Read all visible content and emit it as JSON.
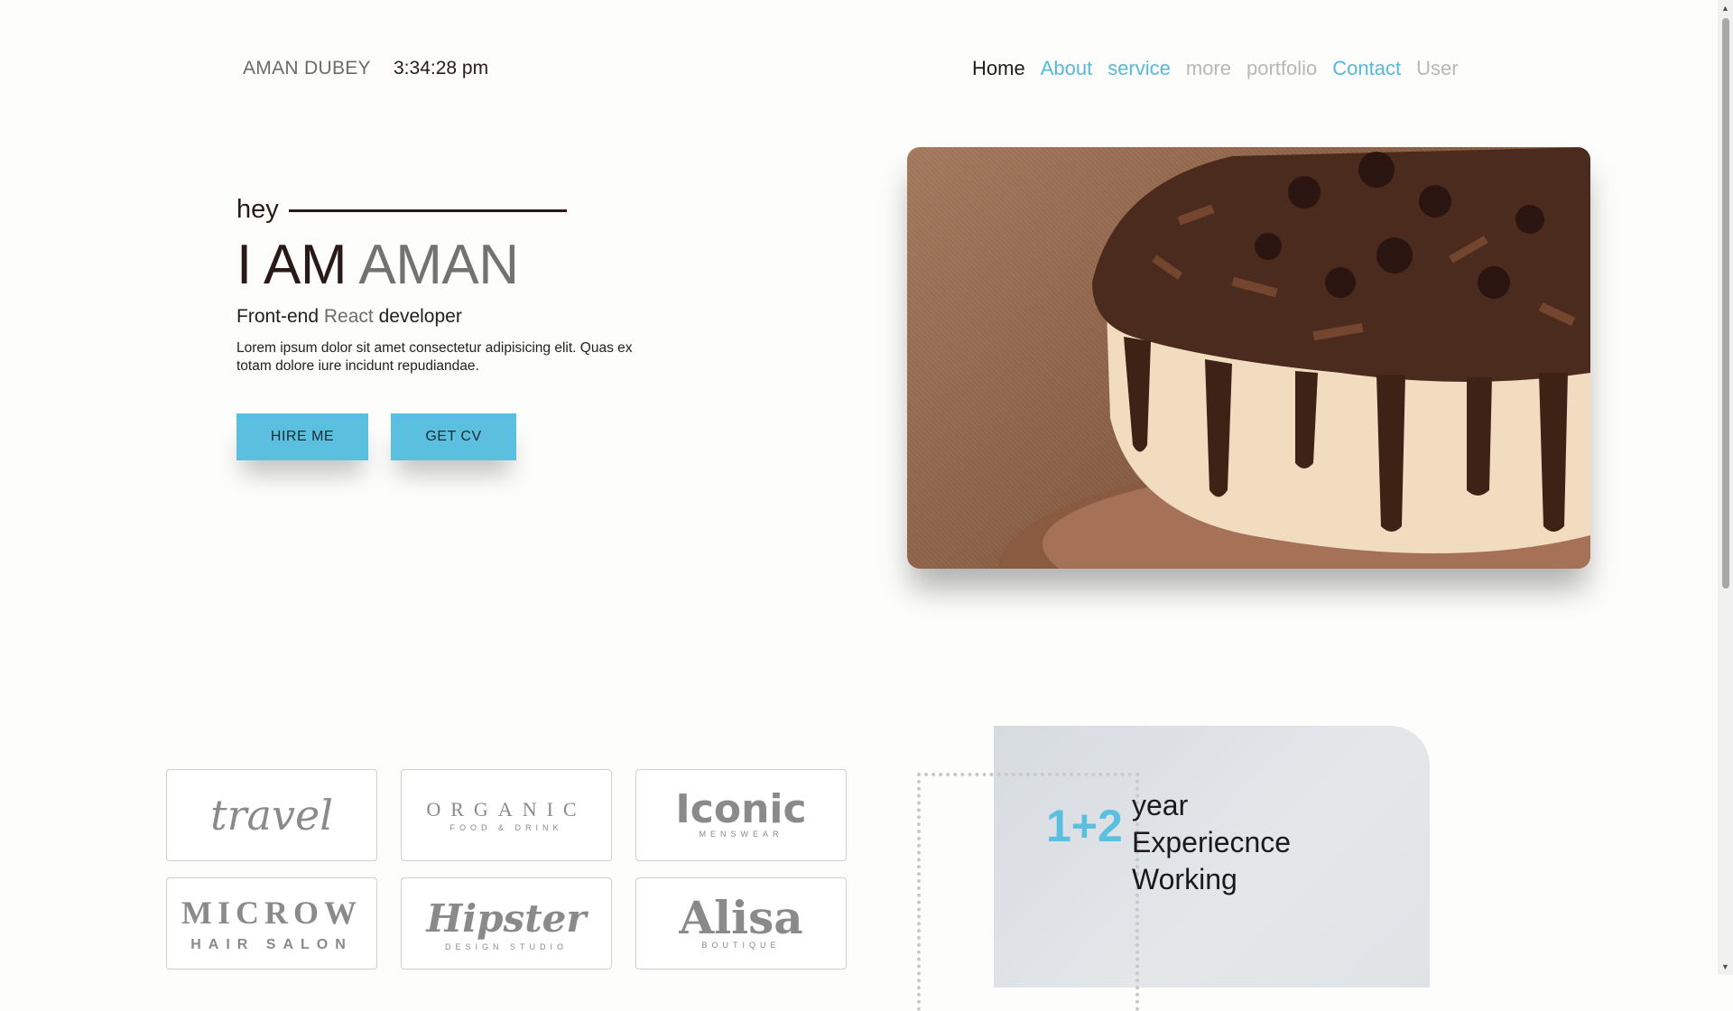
{
  "header": {
    "brand": "AMAN DUBEY",
    "time": "3:34:28 pm",
    "nav": {
      "home": "Home",
      "about": "About",
      "service": "service",
      "more": "more",
      "portfolio": "portfolio",
      "contact": "Contact",
      "user": "User"
    }
  },
  "hero": {
    "greeting": "hey",
    "headline_prefix": "I AM",
    "headline_name": "AMAN",
    "role_before": "Front-end",
    "role_accent": "React",
    "role_after": "developer",
    "description": "Lorem ipsum dolor sit amet consectetur adipisicing elit. Quas ex totam dolore iure incidunt repudiandae.",
    "hire_button": "HIRE ME",
    "cv_button": "GET CV"
  },
  "logos": [
    {
      "title": "travel",
      "subtitle": ""
    },
    {
      "title": "ORGANIC",
      "subtitle": "FOOD & DRINK"
    },
    {
      "title": "Iconic",
      "subtitle": "MENSWEAR"
    },
    {
      "title": "MICROW",
      "subtitle": "HAIR SALON"
    },
    {
      "title": "Hipster",
      "subtitle": "DESIGN STUDIO"
    },
    {
      "title": "Alisa",
      "subtitle": "BOUTIQUE"
    }
  ],
  "experience": {
    "number": "1+2",
    "line1": "year",
    "line2": "Experiecnce",
    "line3": "Working"
  },
  "colors": {
    "accent": "#5bbfe0",
    "text_dark": "#2a1a17",
    "muted": "#727272"
  }
}
